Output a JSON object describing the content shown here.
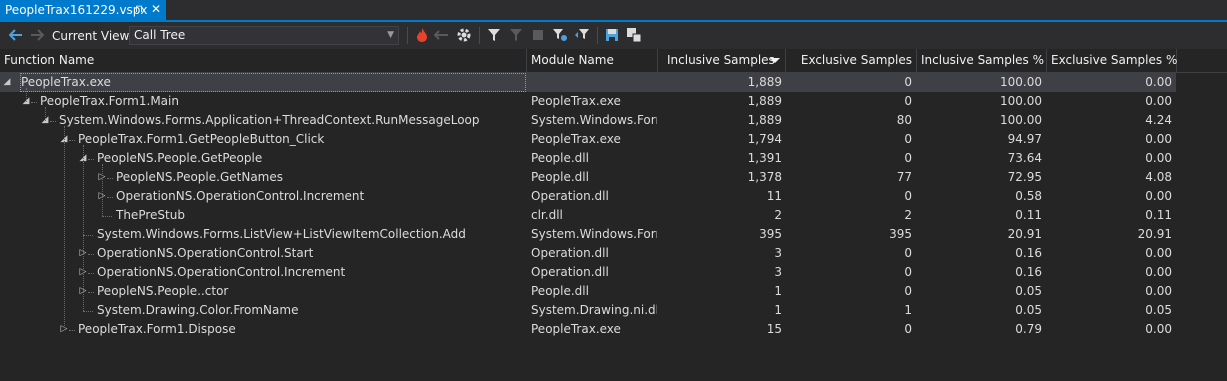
{
  "tab": {
    "title": "PeopleTrax161229.vspx",
    "pin_glyph": "⊓",
    "close_glyph": "✕"
  },
  "toolbar": {
    "current_view_label": "Current View:",
    "current_view_value": "Call Tree",
    "icons": [
      "back-arrow-icon",
      "forward-arrow-icon",
      "hot-path-flame-icon",
      "hot-path-prev-icon",
      "settings-gear-icon",
      "filter-icon",
      "clear-filter-icon",
      "stop-icon",
      "filter-settings-icon",
      "filter-toggle-icon",
      "save-icon",
      "export-icon"
    ],
    "colors": {
      "flame": "#e8412c",
      "accent": "#007acc",
      "save": "#4aa3df"
    }
  },
  "columns": [
    {
      "key": "function",
      "label": "Function Name"
    },
    {
      "key": "module",
      "label": "Module Name"
    },
    {
      "key": "inc",
      "label": "Inclusive Samples"
    },
    {
      "key": "exc",
      "label": "Exclusive Samples"
    },
    {
      "key": "incp",
      "label": "Inclusive Samples %"
    },
    {
      "key": "excp",
      "label": "Exclusive Samples %"
    }
  ],
  "rows": [
    {
      "depth": 0,
      "expander": "expanded",
      "function": "PeopleTrax.exe",
      "module": "",
      "inc": "1,889",
      "exc": "0",
      "incp": "100.00",
      "excp": "0.00",
      "selected": true
    },
    {
      "depth": 1,
      "expander": "expanded",
      "function": "PeopleTrax.Form1.Main",
      "module": "PeopleTrax.exe",
      "inc": "1,889",
      "exc": "0",
      "incp": "100.00",
      "excp": "0.00"
    },
    {
      "depth": 2,
      "expander": "expanded",
      "function": "System.Windows.Forms.Application+ThreadContext.RunMessageLoop",
      "module": "System.Windows.Forms",
      "inc": "1,889",
      "exc": "80",
      "incp": "100.00",
      "excp": "4.24"
    },
    {
      "depth": 3,
      "expander": "expanded",
      "function": "PeopleTrax.Form1.GetPeopleButton_Click",
      "module": "PeopleTrax.exe",
      "inc": "1,794",
      "exc": "0",
      "incp": "94.97",
      "excp": "0.00"
    },
    {
      "depth": 4,
      "expander": "expanded",
      "function": "PeopleNS.People.GetPeople",
      "module": "People.dll",
      "inc": "1,391",
      "exc": "0",
      "incp": "73.64",
      "excp": "0.00"
    },
    {
      "depth": 5,
      "expander": "collapsed",
      "function": "PeopleNS.People.GetNames",
      "module": "People.dll",
      "inc": "1,378",
      "exc": "77",
      "incp": "72.95",
      "excp": "4.08"
    },
    {
      "depth": 5,
      "expander": "collapsed",
      "function": "OperationNS.OperationControl.Increment",
      "module": "Operation.dll",
      "inc": "11",
      "exc": "0",
      "incp": "0.58",
      "excp": "0.00"
    },
    {
      "depth": 5,
      "expander": "leaf",
      "function": "ThePreStub",
      "module": "clr.dll",
      "inc": "2",
      "exc": "2",
      "incp": "0.11",
      "excp": "0.11"
    },
    {
      "depth": 4,
      "expander": "leaf",
      "function": "System.Windows.Forms.ListView+ListViewItemCollection.Add",
      "module": "System.Windows.Forms",
      "inc": "395",
      "exc": "395",
      "incp": "20.91",
      "excp": "20.91"
    },
    {
      "depth": 4,
      "expander": "collapsed",
      "function": "OperationNS.OperationControl.Start",
      "module": "Operation.dll",
      "inc": "3",
      "exc": "0",
      "incp": "0.16",
      "excp": "0.00"
    },
    {
      "depth": 4,
      "expander": "collapsed",
      "function": "OperationNS.OperationControl.Increment",
      "module": "Operation.dll",
      "inc": "3",
      "exc": "0",
      "incp": "0.16",
      "excp": "0.00"
    },
    {
      "depth": 4,
      "expander": "collapsed",
      "function": "PeopleNS.People..ctor",
      "module": "People.dll",
      "inc": "1",
      "exc": "0",
      "incp": "0.05",
      "excp": "0.00"
    },
    {
      "depth": 4,
      "expander": "leaf",
      "function": "System.Drawing.Color.FromName",
      "module": "System.Drawing.ni.dll",
      "inc": "1",
      "exc": "1",
      "incp": "0.05",
      "excp": "0.05"
    },
    {
      "depth": 3,
      "expander": "collapsed",
      "function": "PeopleTrax.Form1.Dispose",
      "module": "PeopleTrax.exe",
      "inc": "15",
      "exc": "0",
      "incp": "0.79",
      "excp": "0.00"
    }
  ]
}
